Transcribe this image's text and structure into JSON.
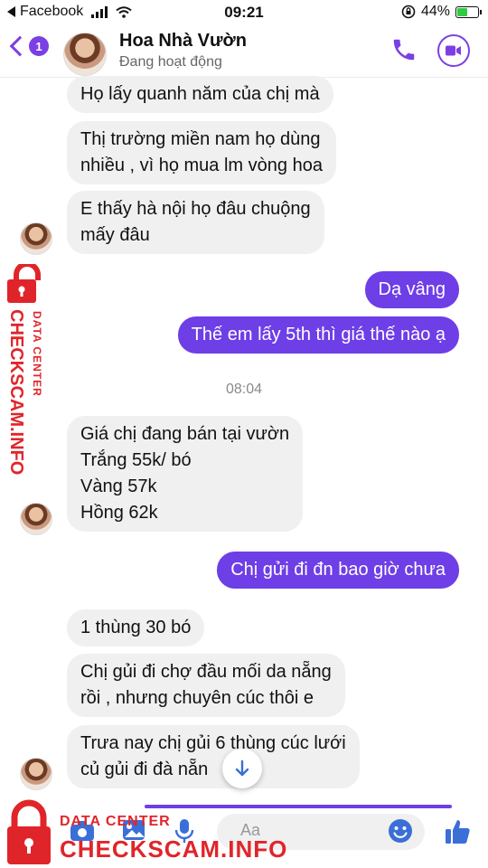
{
  "status_bar": {
    "back_app": "Facebook",
    "time": "09:21",
    "battery": "44%",
    "battery_level": 0.44
  },
  "header": {
    "badge_count": "1",
    "contact_name": "Hoa Nhà Vườn",
    "status": "Đang hoạt động"
  },
  "messages": {
    "m1": "Họ lấy quanh năm của chị mà",
    "m2_line1": "Thị trường miền nam họ dùng",
    "m2_line2": "nhiều , vì họ mua lm vòng hoa",
    "m3_line1": "E thấy hà nội họ đâu chuộng",
    "m3_line2": "mấy đâu",
    "m4": "Dạ vâng",
    "m5": "Thế em lấy 5th thì giá thế nào ạ",
    "timestamp": "08:04",
    "m6_line1": "Giá chị đang bán tại vườn",
    "m6_line2": "Trắng 55k/ bó",
    "m6_line3": "Vàng 57k",
    "m6_line4": "Hồng 62k",
    "m7": "Chị gửi đi đn bao giờ chưa",
    "m8": "1 thùng 30 bó",
    "m9_line1": "Chị gủi đi chợ đầu mối da nẵng",
    "m9_line2": "rồi , nhưng chuyên cúc thôi e",
    "m10_line1": "Trưa nay chị gủi 6 thùng cúc lưới",
    "m10_line2": "củ gủi đi đà nẵn"
  },
  "composer": {
    "placeholder": "Aa"
  },
  "watermark": {
    "side_brand": "CHECKSCAM.INFO",
    "side_sub": "DATA CENTER",
    "bottom_sub": "DATA CENTER",
    "bottom_brand": "CHECKSCAM.INFO"
  },
  "colors": {
    "accent": "#7b3fe4",
    "outgoing_bubble": "#6e3ee6",
    "incoming_bubble": "#f0f0f0",
    "watermark": "#e0252a"
  }
}
